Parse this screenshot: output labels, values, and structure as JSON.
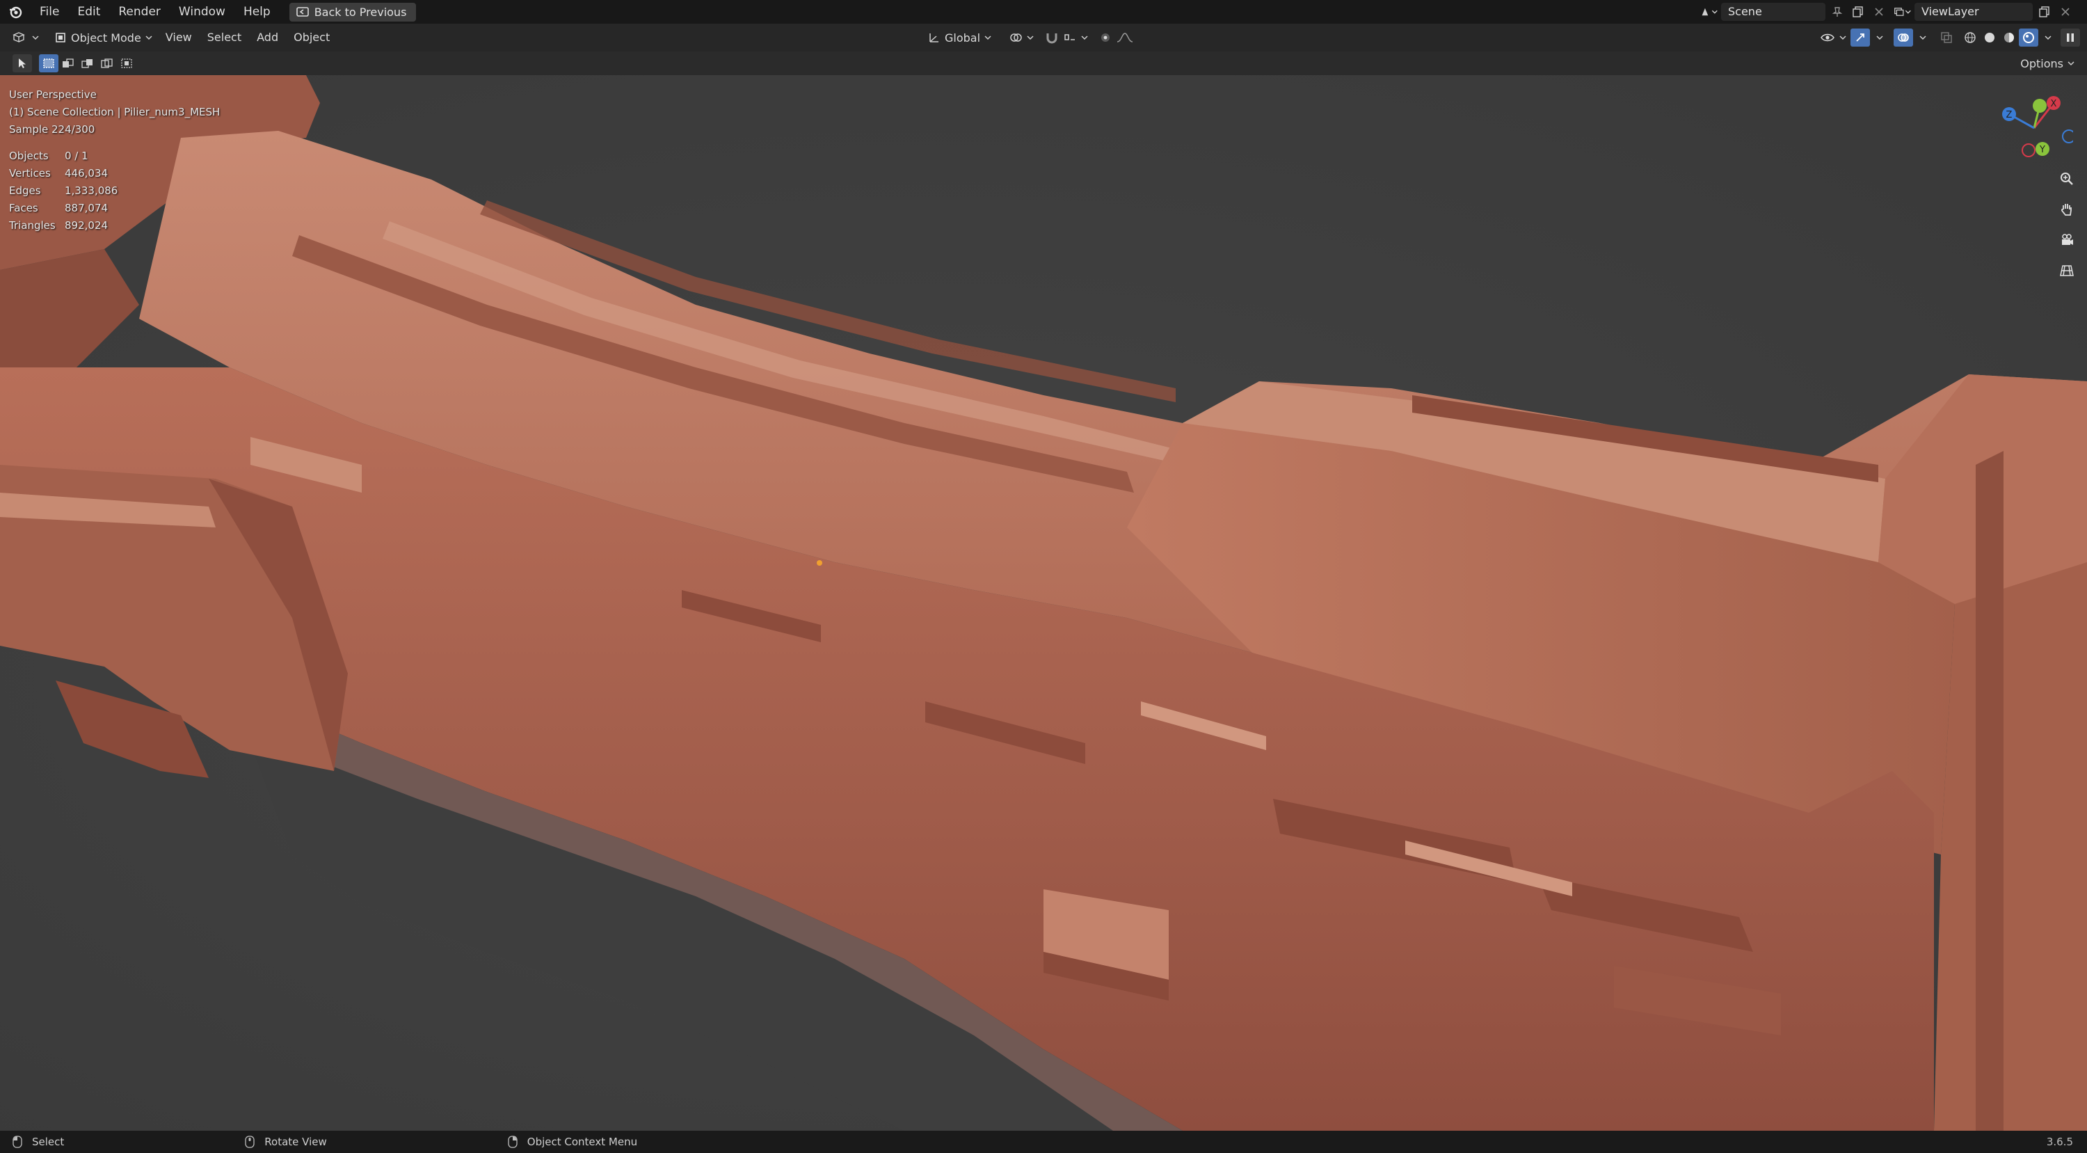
{
  "menubar": {
    "items": [
      "File",
      "Edit",
      "Render",
      "Window",
      "Help"
    ],
    "back_button": "Back to Previous",
    "scene_name": "Scene",
    "view_layer": "ViewLayer"
  },
  "header": {
    "mode": "Object Mode",
    "menus": [
      "View",
      "Select",
      "Add",
      "Object"
    ],
    "transform_orientation": "Global"
  },
  "toolrow": {
    "options_label": "Options"
  },
  "viewport": {
    "perspective": "User Perspective",
    "collection": "(1) Scene Collection | Pilier_num3_MESH",
    "sample": "Sample 224/300",
    "stats": [
      {
        "label": "Objects",
        "value": "0 / 1"
      },
      {
        "label": "Vertices",
        "value": "446,034"
      },
      {
        "label": "Edges",
        "value": "1,333,086"
      },
      {
        "label": "Faces",
        "value": "887,074"
      },
      {
        "label": "Triangles",
        "value": "892,024"
      }
    ],
    "gizmo_axes": {
      "x": "X",
      "y": "Y",
      "z": "Z"
    },
    "mesh_color": "#b8735f",
    "background_color": "#3e3e3e"
  },
  "statusbar": {
    "select": "Select",
    "rotate": "Rotate View",
    "context_menu": "Object Context Menu",
    "version": "3.6.5"
  },
  "colors": {
    "accent": "#4772b3",
    "axis_x": "#d63a4a",
    "axis_y": "#8ac43c",
    "axis_z": "#3a7cd6"
  }
}
